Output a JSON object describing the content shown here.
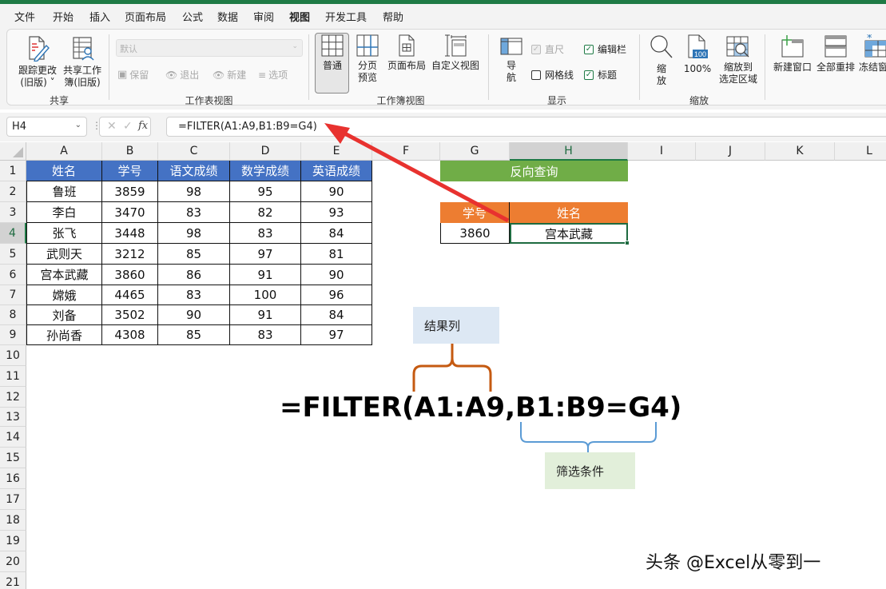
{
  "menu": {
    "items": [
      "文件",
      "开始",
      "插入",
      "页面布局",
      "公式",
      "数据",
      "审阅",
      "视图",
      "开发工具",
      "帮助"
    ],
    "active": "视图"
  },
  "ribbon": {
    "share_group": {
      "label": "共享",
      "track_changes": "跟踪更改\n(旧版)",
      "track_changes_line1": "跟踪更改",
      "track_changes_line2": "(旧版) ˅",
      "share_workbook_line1": "共享工作",
      "share_workbook_line2": "簿(旧版)"
    },
    "sheet_view_group": {
      "label": "工作表视图",
      "select_value": "默认",
      "keep": "保留",
      "exit": "退出",
      "new": "新建",
      "options": "选项"
    },
    "workbook_view_group": {
      "label": "工作簿视图",
      "normal": "普通",
      "page_break_line1": "分页",
      "page_break_line2": "预览",
      "page_layout": "页面布局",
      "custom_views": "自定义视图"
    },
    "show_group": {
      "label": "显示",
      "navigation_line1": "导",
      "navigation_line2": "航",
      "ruler": "直尺",
      "ruler_checked": true,
      "formula_bar": "编辑栏",
      "formula_bar_checked": true,
      "gridlines": "网格线",
      "gridlines_checked": false,
      "headings": "标题",
      "headings_checked": true
    },
    "zoom_group": {
      "label": "缩放",
      "zoom_line1": "缩",
      "zoom_line2": "放",
      "zoom100": "100%",
      "zoom100_icon_text": "100",
      "zoom_selection_line1": "缩放到",
      "zoom_selection_line2": "选定区域"
    },
    "window_group": {
      "new_window": "新建窗口",
      "arrange_all": "全部重排",
      "freeze_panes": "冻结窗"
    }
  },
  "formula_bar": {
    "name_box": "H4",
    "formula": "=FILTER(A1:A9,B1:B9=G4)",
    "fx": "fx"
  },
  "sheet": {
    "columns": [
      "A",
      "B",
      "C",
      "D",
      "E",
      "F",
      "G",
      "H",
      "I",
      "J",
      "K",
      "L"
    ],
    "selected_column": "H",
    "rows": [
      "1",
      "2",
      "3",
      "4",
      "5",
      "6",
      "7",
      "8",
      "9",
      "10",
      "11",
      "12",
      "13",
      "14",
      "15",
      "16",
      "17",
      "18",
      "19",
      "20",
      "21"
    ],
    "selected_row": "4",
    "table": {
      "headers": [
        "姓名",
        "学号",
        "语文成绩",
        "数学成绩",
        "英语成绩"
      ],
      "rows": [
        [
          "鲁班",
          "3859",
          "98",
          "95",
          "90"
        ],
        [
          "李白",
          "3470",
          "83",
          "82",
          "93"
        ],
        [
          "张飞",
          "3448",
          "98",
          "83",
          "84"
        ],
        [
          "武则天",
          "3212",
          "85",
          "97",
          "81"
        ],
        [
          "宫本武藏",
          "3860",
          "86",
          "91",
          "90"
        ],
        [
          "嫦娥",
          "4465",
          "83",
          "100",
          "96"
        ],
        [
          "刘备",
          "3502",
          "90",
          "91",
          "84"
        ],
        [
          "孙尚香",
          "4308",
          "85",
          "83",
          "97"
        ]
      ]
    },
    "lookup": {
      "title": "反向查询",
      "id_header": "学号",
      "name_header": "姓名",
      "id_value": "3860",
      "name_result": "宫本武藏"
    }
  },
  "annotations": {
    "result_column_label": "结果列",
    "filter_condition_label": "筛选条件",
    "big_formula": "=FILTER(A1:A9,B1:B9=G4)",
    "arrow_color": "#e8322f",
    "brace_orange": "#c55a11",
    "brace_blue": "#5b9bd5"
  },
  "watermark": "头条 @Excel从零到一",
  "colors": {
    "excel_green": "#1e7a45",
    "header_blue": "#4472c4",
    "title_green": "#70ad47",
    "header_orange": "#ed7d31",
    "note_blue_bg": "#dde8f4",
    "note_green_bg": "#e2efda"
  }
}
